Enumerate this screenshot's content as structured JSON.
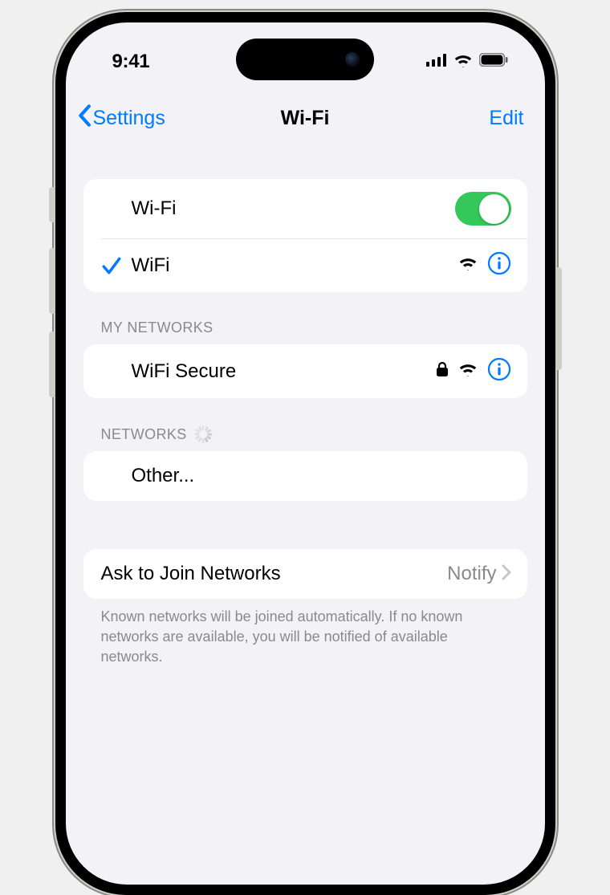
{
  "status_bar": {
    "time": "9:41"
  },
  "nav": {
    "back_label": "Settings",
    "title": "Wi-Fi",
    "edit_label": "Edit"
  },
  "wifi": {
    "master_label": "Wi-Fi",
    "enabled": true,
    "connected_network": "WiFi"
  },
  "sections": {
    "my_networks": {
      "header": "My Networks",
      "items": [
        {
          "name": "WiFi Secure",
          "secured": true
        }
      ]
    },
    "networks": {
      "header": "Networks",
      "other_label": "Other..."
    }
  },
  "ask_to_join": {
    "label": "Ask to Join Networks",
    "value": "Notify",
    "footer": "Known networks will be joined automatically. If no known networks are available, you will be notified of available networks."
  },
  "colors": {
    "accent": "#007aff",
    "toggle_on": "#34c759",
    "bg": "#f2f2f7",
    "secondary": "#8a8a8e"
  }
}
